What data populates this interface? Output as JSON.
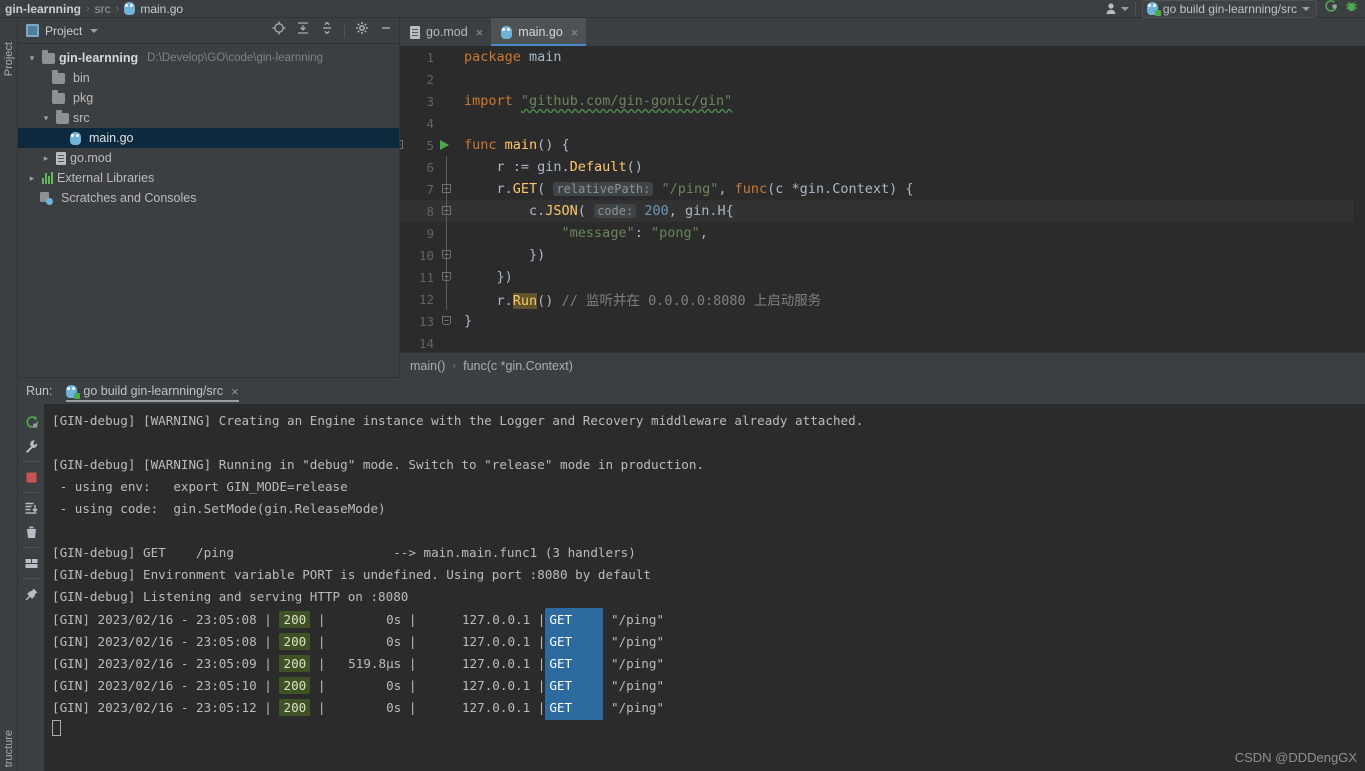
{
  "titlebar": {
    "breadcrumb": [
      "gin-learnning",
      "src",
      "main.go"
    ],
    "separator": "›",
    "user_icon": "user-avatar-icon",
    "run_config": {
      "label": "go build gin-learnning/src",
      "icon": "go-run-config-icon",
      "caret": "chevron-down-icon"
    },
    "run_button": "run-icon",
    "debug_button": "debug-icon"
  },
  "left_strip": {
    "project_label": "Project",
    "structure_label": "tructure"
  },
  "project_panel": {
    "title": "Project",
    "title_caret": "chevron-down-icon",
    "tools": [
      "locate-target-icon",
      "expand-all-icon",
      "collapse-all-icon",
      "settings-gear-icon",
      "minimize-icon"
    ],
    "tree": [
      {
        "label": "gin-learnning",
        "path": "D:\\Develop\\GO\\code\\gin-learnning",
        "icon": "folder-icon",
        "arrow": "expanded",
        "depth": 0,
        "bold": true,
        "selected": false
      },
      {
        "label": "bin",
        "path": "",
        "icon": "folder-icon",
        "arrow": "none",
        "depth": 1,
        "bold": false,
        "selected": false
      },
      {
        "label": "pkg",
        "path": "",
        "icon": "folder-icon",
        "arrow": "none",
        "depth": 1,
        "bold": false,
        "selected": false
      },
      {
        "label": "src",
        "path": "",
        "icon": "folder-icon",
        "arrow": "expanded",
        "depth": 1,
        "bold": false,
        "selected": false
      },
      {
        "label": "main.go",
        "path": "",
        "icon": "go-file-icon",
        "arrow": "none",
        "depth": 2,
        "bold": false,
        "selected": true
      },
      {
        "label": "go.mod",
        "path": "",
        "icon": "go-mod-file-icon",
        "arrow": "collapsed",
        "depth": 1,
        "bold": false,
        "selected": false
      },
      {
        "label": "External Libraries",
        "path": "",
        "icon": "libraries-icon",
        "arrow": "collapsed",
        "depth": 0,
        "bold": false,
        "selected": false
      },
      {
        "label": "Scratches and Consoles",
        "path": "",
        "icon": "scratches-icon",
        "arrow": "none",
        "depth": 0,
        "bold": false,
        "selected": false
      }
    ]
  },
  "editor": {
    "tabs": [
      {
        "label": "go.mod",
        "icon": "go-mod-file-icon",
        "active": false,
        "close": "×"
      },
      {
        "label": "main.go",
        "icon": "go-file-icon",
        "active": true,
        "close": "×"
      }
    ],
    "lines": [
      {
        "n": "1",
        "text": "package main"
      },
      {
        "n": "2",
        "text": ""
      },
      {
        "n": "3",
        "text": "import \"github.com/gin-gonic/gin\""
      },
      {
        "n": "4",
        "text": ""
      },
      {
        "n": "5",
        "text": "func main() {"
      },
      {
        "n": "6",
        "text": "    r := gin.Default()"
      },
      {
        "n": "7",
        "text": "    r.GET( relativePath: \"/ping\", func(c *gin.Context) {"
      },
      {
        "n": "8",
        "text": "        c.JSON( code: 200, gin.H{"
      },
      {
        "n": "9",
        "text": "            \"message\": \"pong\","
      },
      {
        "n": "10",
        "text": "        })"
      },
      {
        "n": "11",
        "text": "    })"
      },
      {
        "n": "12",
        "text": "    r.Run() // 监听并在 0.0.0.0:8080 上启动服务"
      },
      {
        "n": "13",
        "text": "}"
      },
      {
        "n": "14",
        "text": ""
      }
    ],
    "import_path": "\"github.com/gin-gonic/gin\"",
    "hint_relative_path": "relativePath:",
    "hint_code": "code:",
    "highlighted_identifier": "Run",
    "comment_line12": "// 监听并在 0.0.0.0:8080 上启动服务",
    "breadcrumbs": [
      "main()",
      "func(c *gin.Context)"
    ],
    "breadcrumb_separator": "›",
    "gutter_run_icon": "run-gutter-icon"
  },
  "run_panel": {
    "label": "Run:",
    "tab_label": "go build gin-learnning/src",
    "tab_close": "×",
    "tools": [
      "rerun-icon",
      "wrench-icon",
      "stop-icon",
      "scroll-to-end-icon",
      "trash-icon",
      "layout-icon",
      "pin-icon"
    ],
    "console_lines": [
      {
        "type": "text",
        "text": "[GIN-debug] [WARNING] Creating an Engine instance with the Logger and Recovery middleware already attached."
      },
      {
        "type": "text",
        "text": ""
      },
      {
        "type": "text",
        "text": "[GIN-debug] [WARNING] Running in \"debug\" mode. Switch to \"release\" mode in production."
      },
      {
        "type": "text",
        "text": " - using env:   export GIN_MODE=release"
      },
      {
        "type": "text",
        "text": " - using code:  gin.SetMode(gin.ReleaseMode)"
      },
      {
        "type": "text",
        "text": ""
      },
      {
        "type": "text",
        "text": "[GIN-debug] GET    /ping                     --> main.main.func1 (3 handlers)"
      },
      {
        "type": "text",
        "text": "[GIN-debug] Environment variable PORT is undefined. Using port :8080 by default"
      },
      {
        "type": "text",
        "text": "[GIN-debug] Listening and serving HTTP on :8080"
      }
    ],
    "request_log": [
      {
        "prefix": "[GIN] 2023/02/16 - 23:05:08 |",
        "status": "200",
        "mid": "|",
        "latency": "0s",
        "sep2": "|",
        "ip": "127.0.0.1",
        "sep3": "|",
        "method": "GET",
        "path": "\"/ping\""
      },
      {
        "prefix": "[GIN] 2023/02/16 - 23:05:08 |",
        "status": "200",
        "mid": "|",
        "latency": "0s",
        "sep2": "|",
        "ip": "127.0.0.1",
        "sep3": "|",
        "method": "GET",
        "path": "\"/ping\""
      },
      {
        "prefix": "[GIN] 2023/02/16 - 23:05:09 |",
        "status": "200",
        "mid": "|",
        "latency": "519.8µs",
        "sep2": "|",
        "ip": "127.0.0.1",
        "sep3": "|",
        "method": "GET",
        "path": "\"/ping\""
      },
      {
        "prefix": "[GIN] 2023/02/16 - 23:05:10 |",
        "status": "200",
        "mid": "|",
        "latency": "0s",
        "sep2": "|",
        "ip": "127.0.0.1",
        "sep3": "|",
        "method": "GET",
        "path": "\"/ping\""
      },
      {
        "prefix": "[GIN] 2023/02/16 - 23:05:12 |",
        "status": "200",
        "mid": "|",
        "latency": "0s",
        "sep2": "|",
        "ip": "127.0.0.1",
        "sep3": "|",
        "method": "GET",
        "path": "\"/ping\""
      }
    ]
  },
  "watermark": "CSDN @DDDengGX",
  "colors": {
    "status_200_bg": "#3f5223",
    "method_get_bg": "#2d6a9f",
    "editor_bg": "#2b2b2b",
    "panel_bg": "#3c3f41",
    "selection_bg": "#0d293e",
    "keyword": "#cc7832",
    "string": "#6a8759",
    "number": "#6897bb",
    "function": "#ffc66d",
    "accent_green": "#4ea84e"
  }
}
